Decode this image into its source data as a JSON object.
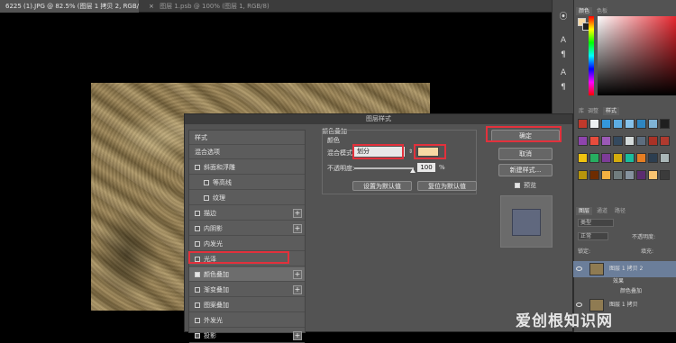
{
  "tabs": [
    {
      "label": "6225 (1).JPG @ 82.5% (图层 1 拷贝 2, RGB/8) *",
      "active": true
    },
    {
      "label": "图层 1.psb @ 100% (图层 1, RGB/8)",
      "active": false
    }
  ],
  "dialog": {
    "title": "图层样式",
    "styles_header": "样式",
    "styles": [
      {
        "label": "混合选项",
        "checkbox": false,
        "checked": false,
        "plus": false,
        "sub": false
      },
      {
        "label": "斜面和浮雕",
        "checkbox": true,
        "checked": false,
        "plus": false,
        "sub": false
      },
      {
        "label": "等高线",
        "checkbox": true,
        "checked": false,
        "plus": false,
        "sub": true
      },
      {
        "label": "纹理",
        "checkbox": true,
        "checked": false,
        "plus": false,
        "sub": true
      },
      {
        "label": "描边",
        "checkbox": true,
        "checked": false,
        "plus": true,
        "sub": false
      },
      {
        "label": "内阴影",
        "checkbox": true,
        "checked": false,
        "plus": true,
        "sub": false
      },
      {
        "label": "内发光",
        "checkbox": true,
        "checked": false,
        "plus": false,
        "sub": false
      },
      {
        "label": "光泽",
        "checkbox": true,
        "checked": false,
        "plus": false,
        "sub": false
      },
      {
        "label": "颜色叠加",
        "checkbox": true,
        "checked": true,
        "plus": true,
        "sub": false,
        "selected": true
      },
      {
        "label": "渐变叠加",
        "checkbox": true,
        "checked": false,
        "plus": true,
        "sub": false
      },
      {
        "label": "图案叠加",
        "checkbox": true,
        "checked": false,
        "plus": false,
        "sub": false
      },
      {
        "label": "外发光",
        "checkbox": true,
        "checked": false,
        "plus": false,
        "sub": false
      },
      {
        "label": "投影",
        "checkbox": true,
        "checked": false,
        "plus": true,
        "sub": false
      }
    ],
    "section_title": "颜色叠加",
    "group_title": "颜色",
    "blend_label": "混合模式:",
    "blend_value": "划分",
    "overlay_color": "#f7d9a4",
    "opacity_label": "不透明度:",
    "opacity_value": "100",
    "opacity_unit": "%",
    "opacity_fraction": 1.0,
    "set_default_label": "设置为默认值",
    "reset_default_label": "复位为默认值",
    "ok_label": "确定",
    "cancel_label": "取消",
    "new_style_label": "新建样式...",
    "preview_label": "预览",
    "preview_checked": true,
    "preview_color": "#60687e"
  },
  "panels": {
    "color_tab": "颜色",
    "swatches_tab": "色板",
    "mid_tabs": [
      "库",
      "调整",
      "样式"
    ],
    "layers_tabs": [
      "图层",
      "通道",
      "路径"
    ],
    "kind_label": "类型",
    "blend_mode": "正常",
    "opacity_label": "不透明度:",
    "lock_label": "锁定:",
    "fill_label": "填充:",
    "layers": [
      {
        "name": "图层 1 拷贝 2",
        "selected": true
      },
      {
        "name": "效果",
        "selected": false
      },
      {
        "name": "颜色叠加",
        "selected": false
      },
      {
        "name": "图层 1 拷贝",
        "selected": false
      }
    ]
  },
  "watermark": "爱创根知识网",
  "icons": [
    "close-icon",
    "eye-icon",
    "plus-icon",
    "checkbox-icon",
    "dropdown-arrow-icon",
    "text-tool-icon",
    "paragraph-icon",
    "character-icon"
  ]
}
